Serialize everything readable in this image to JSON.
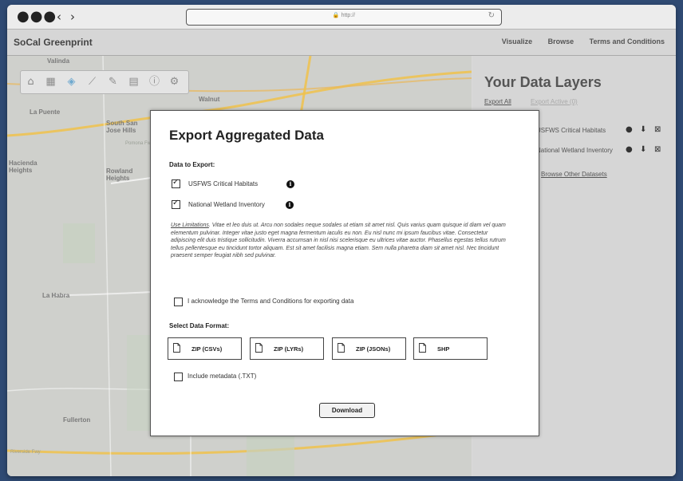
{
  "browser": {
    "dots": "●●●",
    "back": "‹",
    "forward": "›",
    "url": "🔒 http://",
    "reload": "↻"
  },
  "app": {
    "brand": "SoCal Greenprint",
    "nav": [
      "Visualize",
      "Browse",
      "Terms and Conditions"
    ]
  },
  "map": {
    "labels": [
      "Valinda",
      "Walnut",
      "La Puente",
      "South San Jose Hills",
      "Rowland Heights",
      "Pomona Fwy",
      "La Habra",
      "Fullerton",
      "Riverside Fwy",
      "Hacienda Heights"
    ],
    "tools": [
      "home-icon",
      "layers-grid-icon",
      "stack-icon",
      "measure-icon",
      "edit-icon",
      "print-icon",
      "info-icon",
      "settings-icon"
    ]
  },
  "panel": {
    "title": "Your Data Layers",
    "export_all": "Export All",
    "export_active": "Export Active (0)",
    "layers": [
      "USFWS Critical Habitats",
      "National Wetland Inventory"
    ],
    "browse_link": "Browse Other Datasets"
  },
  "modal": {
    "title": "Export Aggregated Data",
    "data_label": "Data to Export:",
    "datasets": [
      {
        "label": "USFWS Critical Habitats",
        "checked": true
      },
      {
        "label": "National Wetland Inventory",
        "checked": true
      }
    ],
    "terms_heading": "Use Limitations",
    "terms_body": ". Vitae et leo duis ut. Arcu non sodales neque sodales ut etiam sit amet nisl. Quis varius quam quisque id diam vel quam elementum pulvinar. Integer vitae justo eget magna fermentum iaculis eu non. Eu nisl nunc mi ipsum faucibus vitae. Consectetur adipiscing elit duis tristique sollicitudin. Viverra accumsan in nisl nisi scelerisque eu ultrices vitae auctor. Phasellus egestas tellus rutrum tellus pellentesque eu tincidunt tortor aliquam. Est sit amet facilisis magna etiam. Sem nulla pharetra diam sit amet nisl. Nec tincidunt praesent semper feugiat nibh sed pulvinar.",
    "acknowledge": "I acknowledge the Terms and Conditions for exporting data",
    "format_label": "Select Data Format:",
    "formats": [
      "ZIP (CSVs)",
      "ZIP (LYRs)",
      "ZIP (JSONs)",
      "SHP"
    ],
    "metadata": "Include metadata (.TXT)",
    "download": "Download"
  },
  "colors": {
    "background": "#2f4a73",
    "map": "#cfd0cc",
    "panel": "#d6d6d6",
    "active_tool": "#6fa9cf",
    "road": "#f5a623"
  }
}
